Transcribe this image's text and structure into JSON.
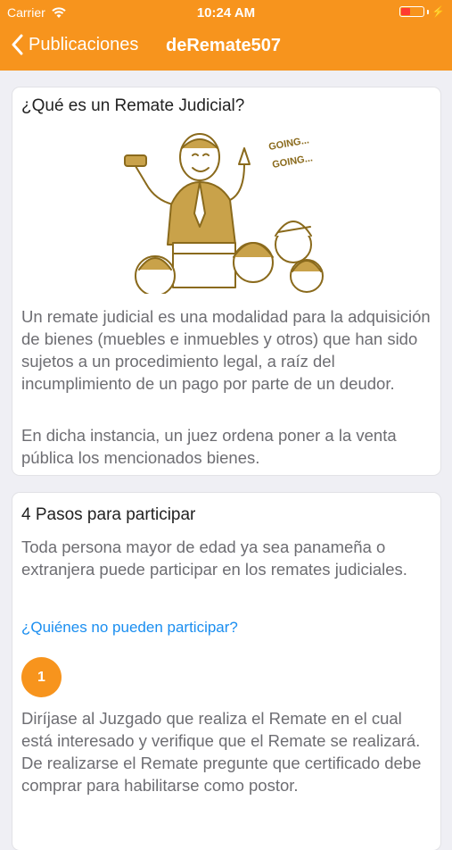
{
  "status_bar": {
    "carrier": "Carrier",
    "time": "10:24 AM",
    "icons": [
      "wifi-icon",
      "battery-icon",
      "charging-bolt-icon"
    ]
  },
  "nav": {
    "back_label": "Publicaciones",
    "title": "deRemate507",
    "background_color": "#f7941d"
  },
  "section1": {
    "title": "¿Qué es un Remate Judicial?",
    "illustration": {
      "icon": "auctioneer-illustration",
      "caption_lines": [
        "GOING...",
        "GOING..."
      ]
    },
    "paragraphs": [
      "Un remate judicial es una modalidad para la adquisición de bienes (muebles e inmuebles y otros) que han sido sujetos a un procedimiento legal, a raíz del incumplimiento de un pago por parte de un deudor.",
      "En dicha instancia, un juez ordena poner a la venta pública los mencionados bienes."
    ]
  },
  "section2": {
    "title": "4 Pasos para participar",
    "intro": "Toda persona mayor de edad ya sea panameña o extranjera puede participar en los remates judiciales.",
    "link": "¿Quiénes no pueden participar?",
    "steps": [
      {
        "number": "1",
        "text": "Diríjase al Juzgado que realiza el Remate en el cual está interesado y verifique que el Remate se realizará. De realizarse el Remate pregunte que certificado debe comprar para habilitarse como postor."
      }
    ]
  },
  "colors": {
    "accent": "#f7941d",
    "link": "#1a8ef0",
    "body_text": "#6d6d72"
  }
}
